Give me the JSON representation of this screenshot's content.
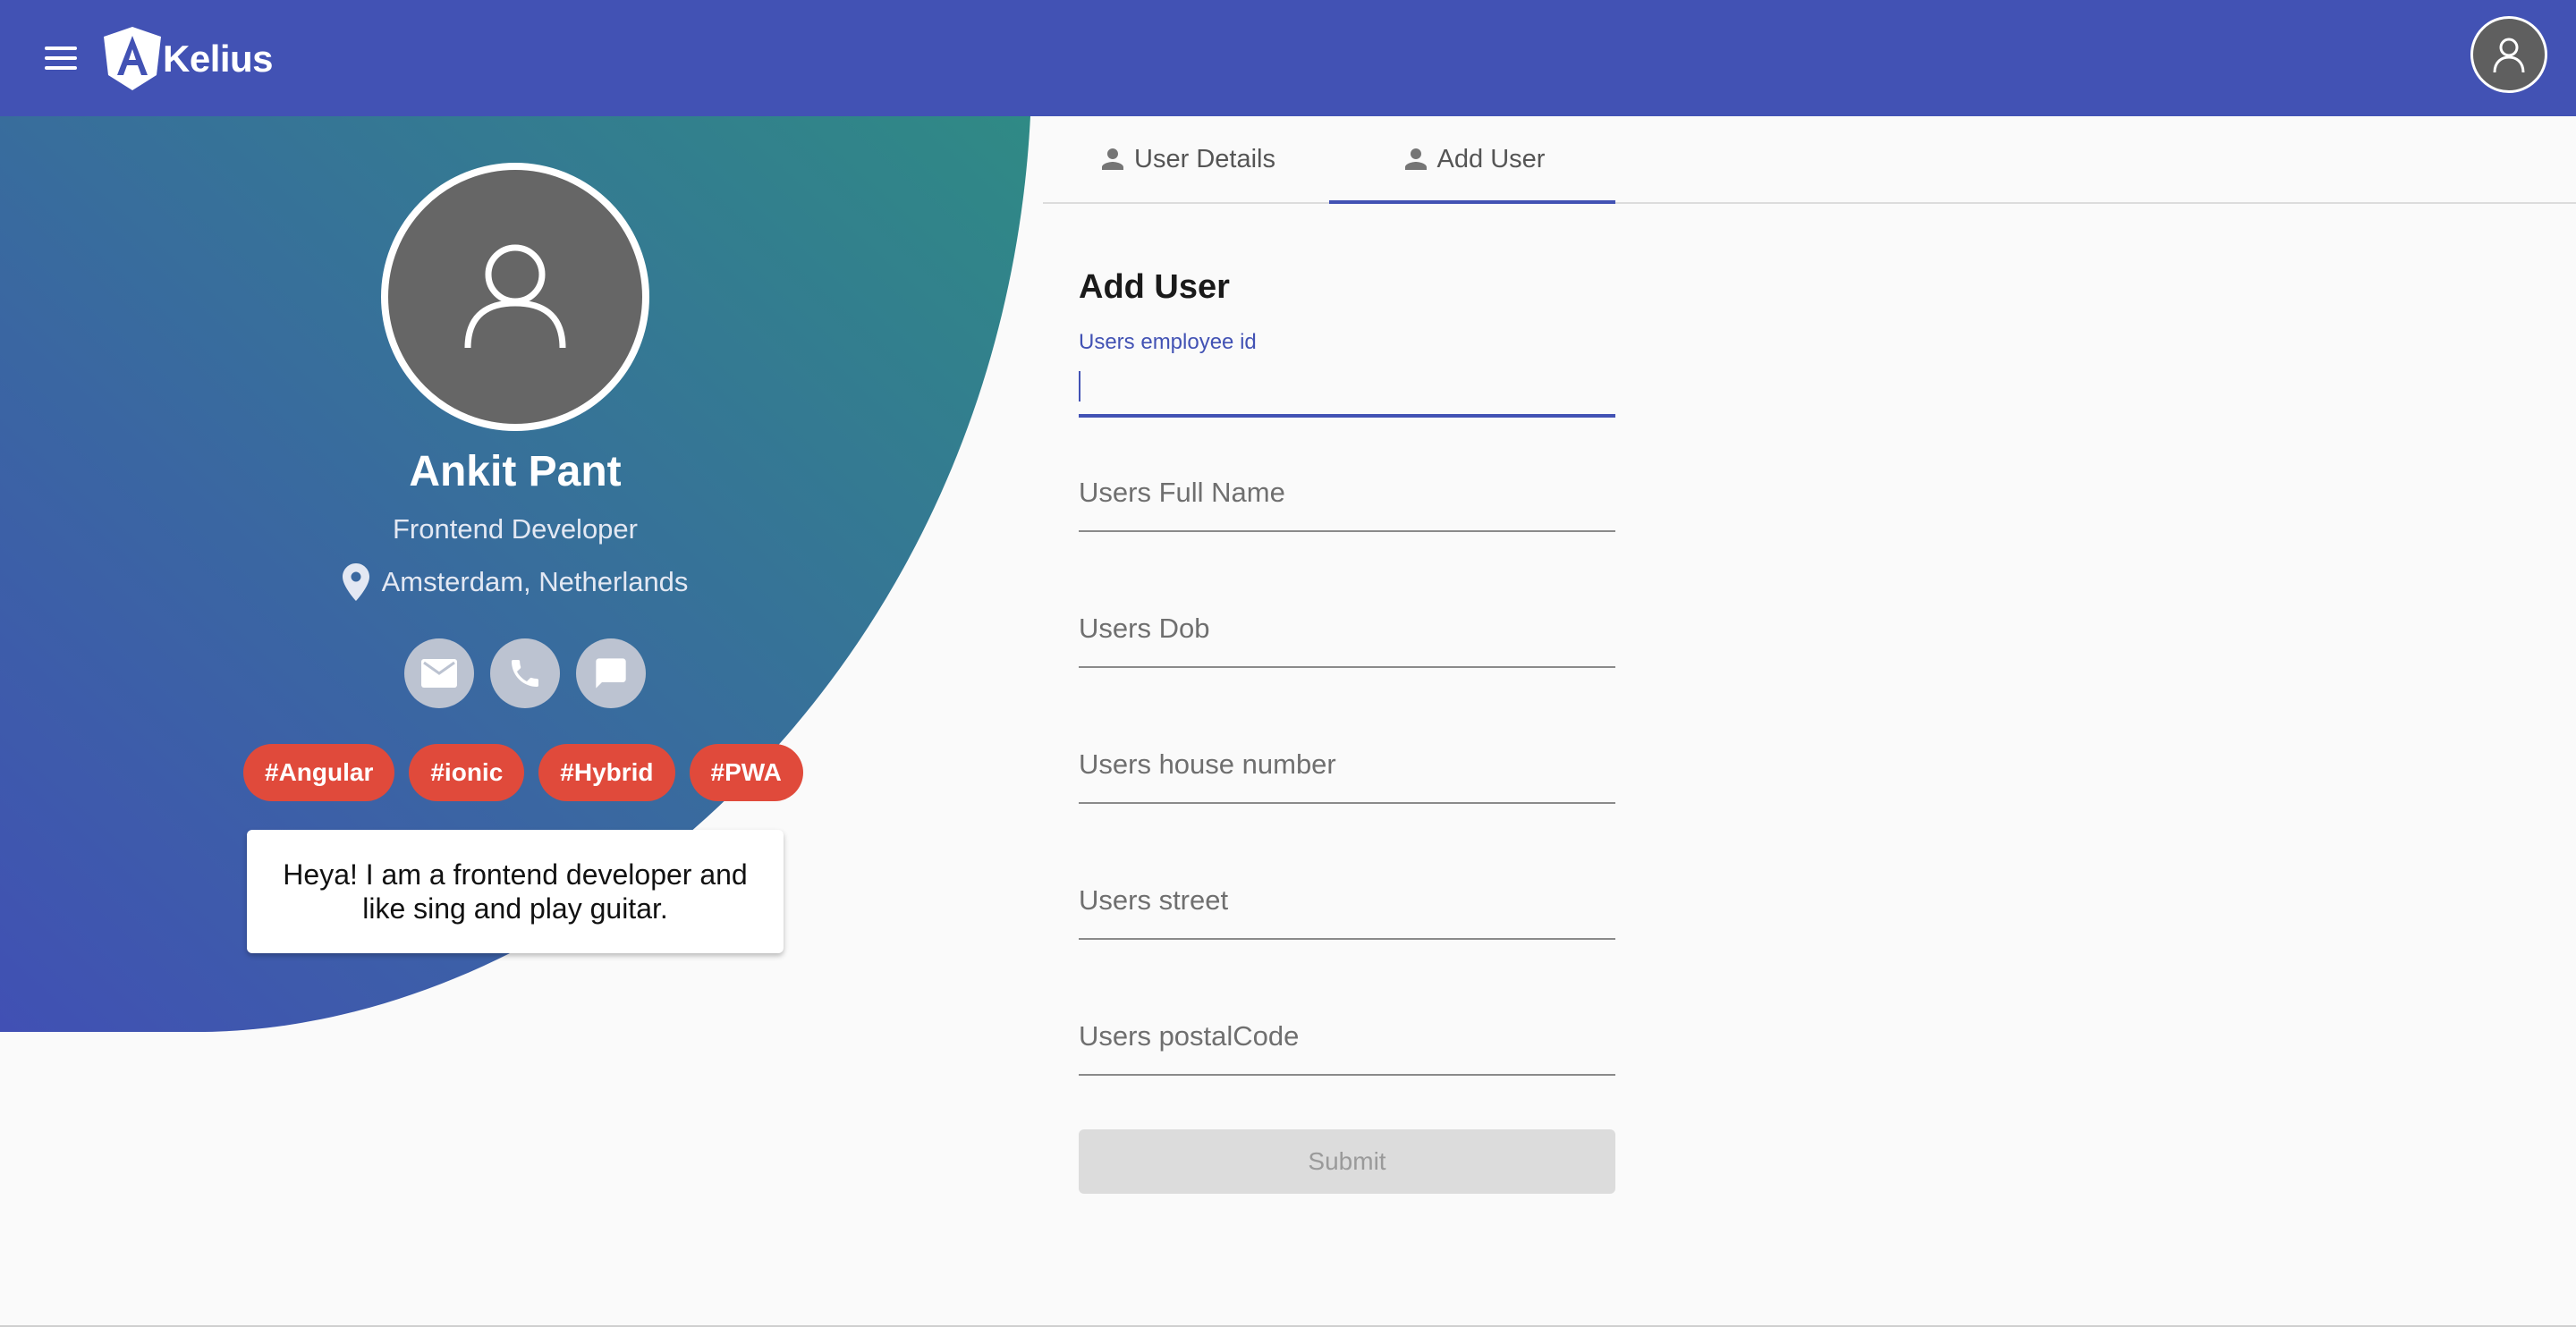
{
  "app": {
    "brand_name": "Kelius",
    "colors": {
      "primary": "#4252b4",
      "gradient_start": "#4150b4",
      "gradient_end": "#2f8a85",
      "tag": "#e04a3b"
    }
  },
  "toolbar": {
    "menu_icon": "hamburger-menu-icon",
    "account_icon": "account-circle-icon"
  },
  "profile": {
    "name": "Ankit Pant",
    "role": "Frontend Developer",
    "location": "Amsterdam, Netherlands",
    "contacts": [
      "mail-icon",
      "phone-icon",
      "chat-icon"
    ],
    "tags": [
      "#Angular",
      "#ionic",
      "#Hybrid",
      "#PWA"
    ],
    "bio": "Heya! I am a frontend developer and like sing and play guitar."
  },
  "tabs": [
    {
      "label": "User Details",
      "active": false
    },
    {
      "label": "Add User",
      "active": true
    }
  ],
  "form": {
    "title": "Add User",
    "fields": [
      {
        "label": "Users employee id",
        "value": "",
        "focused": true
      },
      {
        "label": "Users Full Name",
        "value": ""
      },
      {
        "label": "Users Dob",
        "value": ""
      },
      {
        "label": "Users house number",
        "value": ""
      },
      {
        "label": "Users street",
        "value": ""
      },
      {
        "label": "Users postalCode",
        "value": ""
      }
    ],
    "submit_label": "Submit"
  }
}
